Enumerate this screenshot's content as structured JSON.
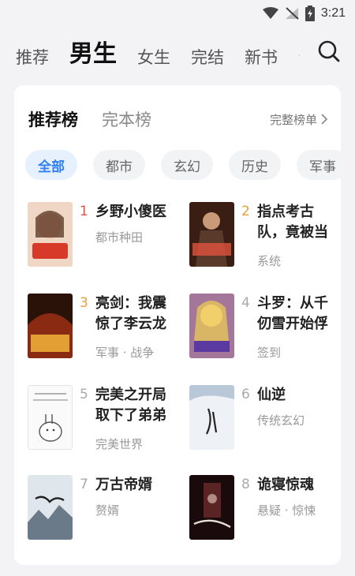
{
  "status": {
    "time": "3:21"
  },
  "nav": {
    "tabs": [
      "推荐",
      "男生",
      "女生",
      "完结",
      "新书",
      "诊"
    ],
    "active_index": 1
  },
  "card": {
    "rank_tabs": [
      "推荐榜",
      "完本榜"
    ],
    "full_list": "完整榜单",
    "categories": [
      "全部",
      "都市",
      "玄幻",
      "历史",
      "军事"
    ],
    "books": [
      {
        "rank": "1",
        "title": "乡野小傻医",
        "tag": "都市种田",
        "cover_color": "#d9a07c"
      },
      {
        "rank": "2",
        "title": "指点考古队，竟被当",
        "tag": "系统",
        "cover_color": "#8a4a2a"
      },
      {
        "rank": "3",
        "title": "亮剑：我震惊了李云龙",
        "tag": "军事 · 战争",
        "cover_color": "#6b2a18"
      },
      {
        "rank": "4",
        "title": "斗罗：从千仞雪开始俘",
        "tag": "签到",
        "cover_color": "#c59a6a"
      },
      {
        "rank": "5",
        "title": "完美之开局取下了弟弟",
        "tag": "完美世界",
        "cover_color": "#efefef"
      },
      {
        "rank": "6",
        "title": "仙逆",
        "tag": "传统玄幻",
        "cover_color": "#dfe6ee"
      },
      {
        "rank": "7",
        "title": "万古帝婿",
        "tag": "赘婿",
        "cover_color": "#9aa8b4"
      },
      {
        "rank": "8",
        "title": "诡寝惊魂",
        "tag": "悬疑 · 惊悚",
        "cover_color": "#2a1416"
      }
    ]
  }
}
